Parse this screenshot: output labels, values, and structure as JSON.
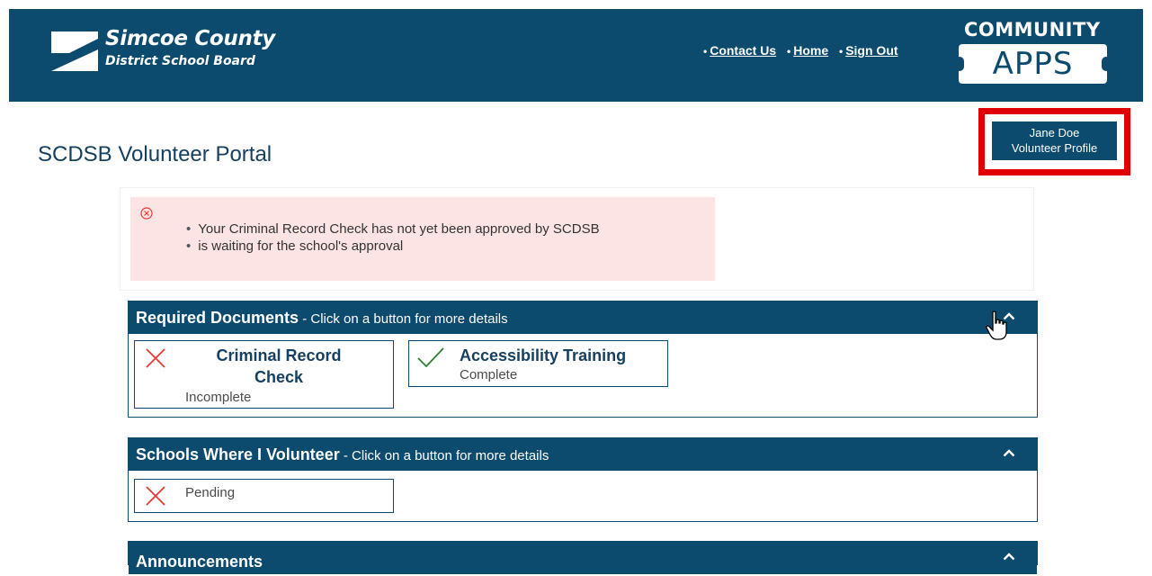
{
  "header": {
    "logo_name": "Simcoe County",
    "logo_sub": "District School Board",
    "nav": [
      "Contact Us",
      "Home",
      "Sign Out"
    ],
    "brand_top": "COMMUNITY",
    "brand_apps": "APPS"
  },
  "page": {
    "title": "SCDSB Volunteer Portal",
    "profile_name": "Jane Doe",
    "profile_label": "Volunteer Profile"
  },
  "alert": {
    "icon": "circle-x-icon",
    "messages": [
      "Your Criminal Record Check has not yet been approved by SCDSB",
      "is waiting for the school's approval"
    ]
  },
  "sections": {
    "required": {
      "title": "Required Documents",
      "hint": " - Click on a button for more details",
      "items": [
        {
          "title_line1": "Criminal Record",
          "title_line2": "Check",
          "status": "Incomplete",
          "icon": "x-icon"
        },
        {
          "title": "Accessibility Training",
          "status": "Complete",
          "icon": "check-icon"
        }
      ]
    },
    "schools": {
      "title": "Schools Where I Volunteer",
      "hint": " - Click on a button for more details",
      "items": [
        {
          "status": "Pending",
          "icon": "x-icon"
        }
      ]
    },
    "announcements": {
      "title": "Announcements"
    }
  },
  "colors": {
    "navy": "#0c4a6e",
    "alert_bg": "#fce4e4",
    "error_red": "#e53935",
    "success_green": "#2e7d32",
    "highlight_red": "#e00000"
  }
}
